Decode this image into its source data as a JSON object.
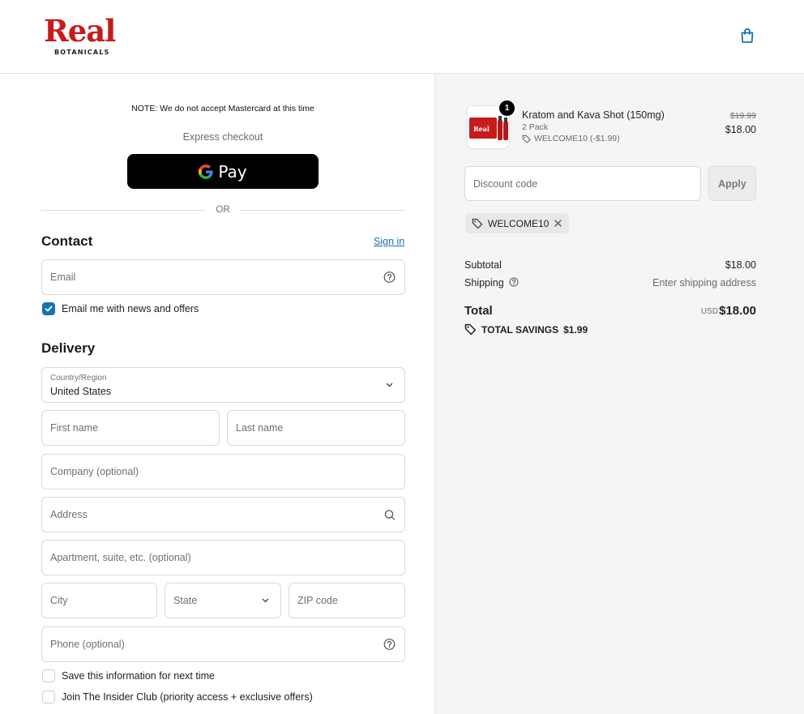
{
  "brand": {
    "name": "Real",
    "tagline": "BOTANICALS",
    "color": "#c81b1b"
  },
  "header": {
    "cart_icon": "shopping-bag-icon"
  },
  "checkout": {
    "note": "NOTE: We do not accept Mastercard at this time",
    "express_label": "Express checkout",
    "gpay_label": "Pay",
    "or_label": "OR"
  },
  "contact": {
    "title": "Contact",
    "signin_label": "Sign in",
    "email_placeholder": "Email",
    "newsletter_label": "Email me with news and offers",
    "newsletter_checked": true
  },
  "delivery": {
    "title": "Delivery",
    "country_label": "Country/Region",
    "country_value": "United States",
    "first_name_placeholder": "First name",
    "last_name_placeholder": "Last name",
    "company_placeholder": "Company (optional)",
    "address_placeholder": "Address",
    "apartment_placeholder": "Apartment, suite, etc. (optional)",
    "city_placeholder": "City",
    "state_label": "State",
    "zip_placeholder": "ZIP code",
    "phone_placeholder": "Phone (optional)",
    "save_info_label": "Save this information for next time",
    "insider_label": "Join The Insider Club (priority access + exclusive offers)"
  },
  "summary": {
    "product": {
      "name": "Kratom and Kava Shot (150mg)",
      "variant": "2 Pack",
      "discount": "WELCOME10 (-$1.99)",
      "quantity": "1",
      "price_original": "$19.99",
      "price_final": "$18.00",
      "thumb_label": "Real"
    },
    "discount_placeholder": "Discount code",
    "apply_label": "Apply",
    "applied_code": "WELCOME10",
    "subtotal_label": "Subtotal",
    "subtotal_value": "$18.00",
    "shipping_label": "Shipping",
    "shipping_value": "Enter shipping address",
    "total_label": "Total",
    "total_currency": "USD",
    "total_value": "$18.00",
    "savings_label": "TOTAL SAVINGS",
    "savings_value": "$1.99"
  },
  "colors": {
    "link": "#1773b0",
    "panel_bg": "#f5f5f5",
    "button_black": "#000000"
  }
}
